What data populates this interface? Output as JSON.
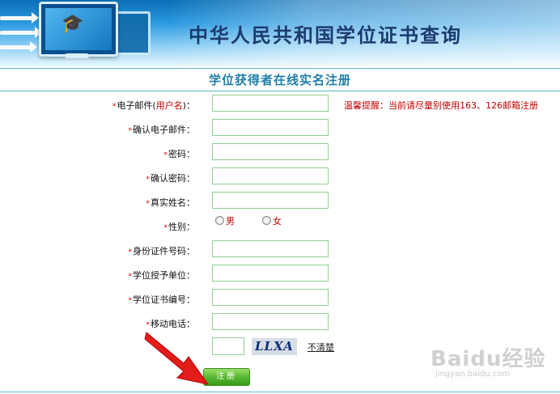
{
  "header": {
    "title": "中华人民共和国学位证书查询"
  },
  "form": {
    "title": "学位获得者在线实名注册",
    "required_mark": "*",
    "hint": "温馨提醒：当前请尽量别使用163、126邮箱注册",
    "email_label_pre": "电子邮件(",
    "email_label_red": "用户名",
    "email_label_post": ")：",
    "confirm_email_label": "确认电子邮件：",
    "password_label": "密码：",
    "confirm_password_label": "确认密码：",
    "real_name_label": "真实姓名：",
    "gender_label": "性别：",
    "gender_male": "男",
    "gender_female": "女",
    "id_number_label": "身份证件号码：",
    "institution_label": "学位授予单位：",
    "certificate_number_label": "学位证书编号：",
    "mobile_label": "移动电话：",
    "captcha_text": "LLXA",
    "captcha_refresh": "不清楚",
    "submit_label": "注册"
  },
  "watermark": {
    "brand": "Baidu经验",
    "url": "jingyan.baidu.com"
  },
  "colors": {
    "accent_title": "#1f7fa8",
    "required": "#d40000",
    "input_border": "#8fcf8f",
    "button": "#52b52d",
    "banner": "#2b9ae0",
    "annotation_arrow": "#e21b1b"
  }
}
